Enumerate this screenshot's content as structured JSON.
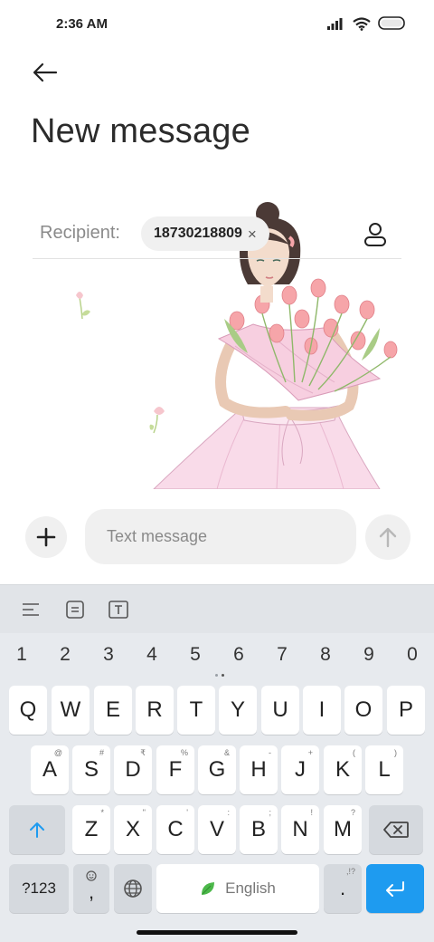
{
  "status_bar": {
    "time": "2:36 AM"
  },
  "header": {
    "title": "New message"
  },
  "recipient": {
    "label": "Recipient:",
    "chip": "18730218809",
    "chip_close": "×"
  },
  "composer": {
    "placeholder": "Text message"
  },
  "keyboard": {
    "numbers": [
      "1",
      "2",
      "3",
      "4",
      "5",
      "6",
      "7",
      "8",
      "9",
      "0"
    ],
    "row1": [
      {
        "key": "Q"
      },
      {
        "key": "W"
      },
      {
        "key": "E"
      },
      {
        "key": "R"
      },
      {
        "key": "T"
      },
      {
        "key": "Y"
      },
      {
        "key": "U"
      },
      {
        "key": "I"
      },
      {
        "key": "O"
      },
      {
        "key": "P"
      }
    ],
    "row2": [
      {
        "key": "A",
        "hint": "@"
      },
      {
        "key": "S",
        "hint": "#"
      },
      {
        "key": "D",
        "hint": "₹"
      },
      {
        "key": "F",
        "hint": "%"
      },
      {
        "key": "G",
        "hint": "&"
      },
      {
        "key": "H",
        "hint": "-"
      },
      {
        "key": "J",
        "hint": "+"
      },
      {
        "key": "K",
        "hint": "("
      },
      {
        "key": "L",
        "hint": ")"
      }
    ],
    "row3": [
      {
        "key": "Z",
        "hint": "*"
      },
      {
        "key": "X",
        "hint": "\""
      },
      {
        "key": "C",
        "hint": "'"
      },
      {
        "key": "V",
        "hint": ":"
      },
      {
        "key": "B",
        "hint": ";"
      },
      {
        "key": "N",
        "hint": "!"
      },
      {
        "key": "M",
        "hint": "?"
      }
    ],
    "symbols_label": "?123",
    "comma_key": ",",
    "space_label": "English",
    "period_key": ".",
    "period_hint": ",!?"
  },
  "colors": {
    "accent": "#1e9bf0",
    "keyboard_bg": "#e7eaee",
    "field_bg": "#f0f0f0"
  }
}
